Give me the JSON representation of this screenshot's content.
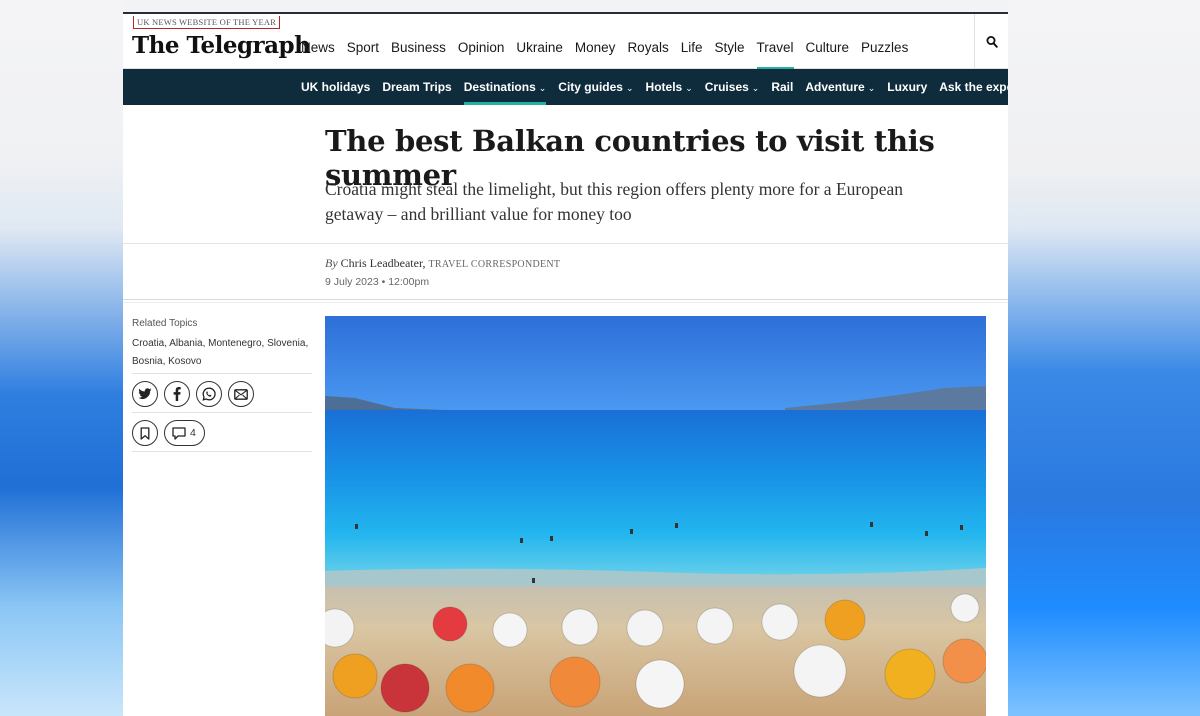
{
  "award": "UK News Website of the Year",
  "logo": "The Telegraph",
  "primary_nav": [
    "News",
    "Sport",
    "Business",
    "Opinion",
    "Ukraine",
    "Money",
    "Royals",
    "Life",
    "Style",
    "Travel",
    "Culture",
    "Puzzles"
  ],
  "primary_nav_active": "Travel",
  "secondary_nav": [
    {
      "label": "UK holidays",
      "dropdown": false
    },
    {
      "label": "Dream Trips",
      "dropdown": false
    },
    {
      "label": "Destinations",
      "dropdown": true,
      "active": true
    },
    {
      "label": "City guides",
      "dropdown": true
    },
    {
      "label": "Hotels",
      "dropdown": true
    },
    {
      "label": "Cruises",
      "dropdown": true
    },
    {
      "label": "Rail",
      "dropdown": false
    },
    {
      "label": "Adventure",
      "dropdown": true
    },
    {
      "label": "Luxury",
      "dropdown": false
    },
    {
      "label": "Ask the experts",
      "dropdown": true
    }
  ],
  "article": {
    "headline": "The best Balkan countries to visit this summer",
    "standfirst": "Croatia might steal the limelight, but this region offers plenty more for a European getaway – and brilliant value for money too",
    "byline_prefix": "By",
    "author": "Chris Leadbeater,",
    "author_role": "TRAVEL CORRESPONDENT",
    "date": "9 July 2023 • 12:00pm"
  },
  "sidebar": {
    "related_label": "Related Topics",
    "related_topics": "Croatia, Albania, Montenegro, Slovenia, Bosnia, Kosovo",
    "comment_count": "4"
  },
  "colors": {
    "nav_bar": "#0f2c3d",
    "accent": "#27b0a0"
  },
  "icons": [
    "search-icon",
    "twitter-icon",
    "facebook-icon",
    "whatsapp-icon",
    "email-icon",
    "bookmark-icon",
    "comment-icon"
  ]
}
